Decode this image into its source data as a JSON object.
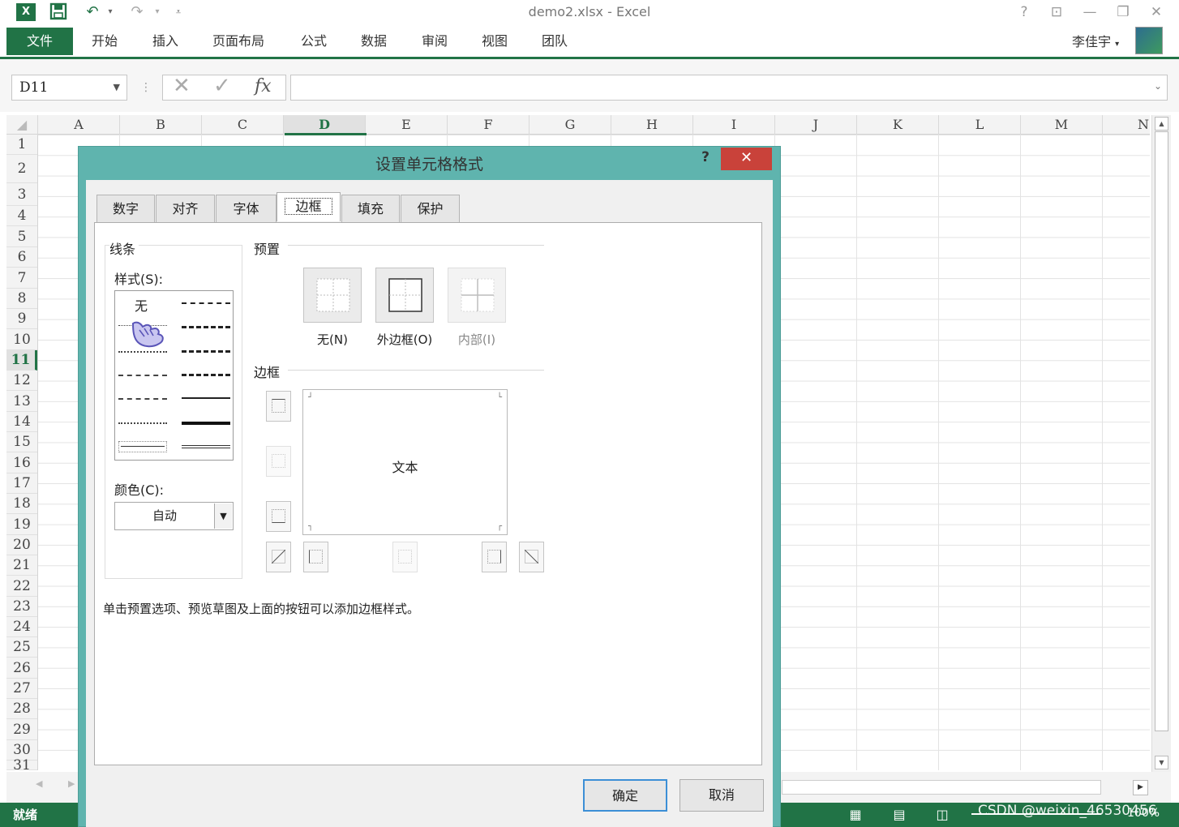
{
  "window": {
    "title": "demo2.xlsx - Excel",
    "help": "?"
  },
  "ribbon": {
    "file": "文件",
    "tabs": [
      "开始",
      "插入",
      "页面布局",
      "公式",
      "数据",
      "审阅",
      "视图",
      "团队"
    ],
    "user": "李佳宇"
  },
  "formula_bar": {
    "name_box": "D11",
    "fx": "fx",
    "value": ""
  },
  "grid": {
    "columns": [
      "A",
      "B",
      "C",
      "D",
      "E",
      "F",
      "G",
      "H",
      "I",
      "J",
      "K",
      "L",
      "M",
      "N"
    ],
    "rows": [
      "1",
      "2",
      "3",
      "4",
      "5",
      "6",
      "7",
      "8",
      "9",
      "10",
      "11",
      "12",
      "13",
      "14",
      "15",
      "16",
      "17",
      "18",
      "19",
      "20",
      "21",
      "22",
      "23",
      "24",
      "25",
      "26",
      "27",
      "28",
      "29",
      "30",
      "31"
    ],
    "active_column": "D",
    "active_row": "11"
  },
  "status": {
    "ready": "就绪",
    "zoom": "100%",
    "watermark": "CSDN @weixin_46530456"
  },
  "dialog": {
    "title": "设置单元格格式",
    "help": "?",
    "close": "✕",
    "tabs": [
      "数字",
      "对齐",
      "字体",
      "边框",
      "填充",
      "保护"
    ],
    "active_tab": "边框",
    "line_group": "线条",
    "style_label": "样式(S):",
    "style_none": "无",
    "color_label": "颜色(C):",
    "color_value": "自动",
    "preset_label": "预置",
    "presets": [
      "无(N)",
      "外边框(O)",
      "内部(I)"
    ],
    "border_label": "边框",
    "preview_text": "文本",
    "hint": "单击预置选项、预览草图及上面的按钮可以添加边框样式。",
    "ok": "确定",
    "cancel": "取消"
  },
  "colors": {
    "excel_green": "#217346",
    "dialog_frame": "#5fb4ae",
    "close_red": "#c9423a",
    "ok_border": "#3c8fd6"
  }
}
